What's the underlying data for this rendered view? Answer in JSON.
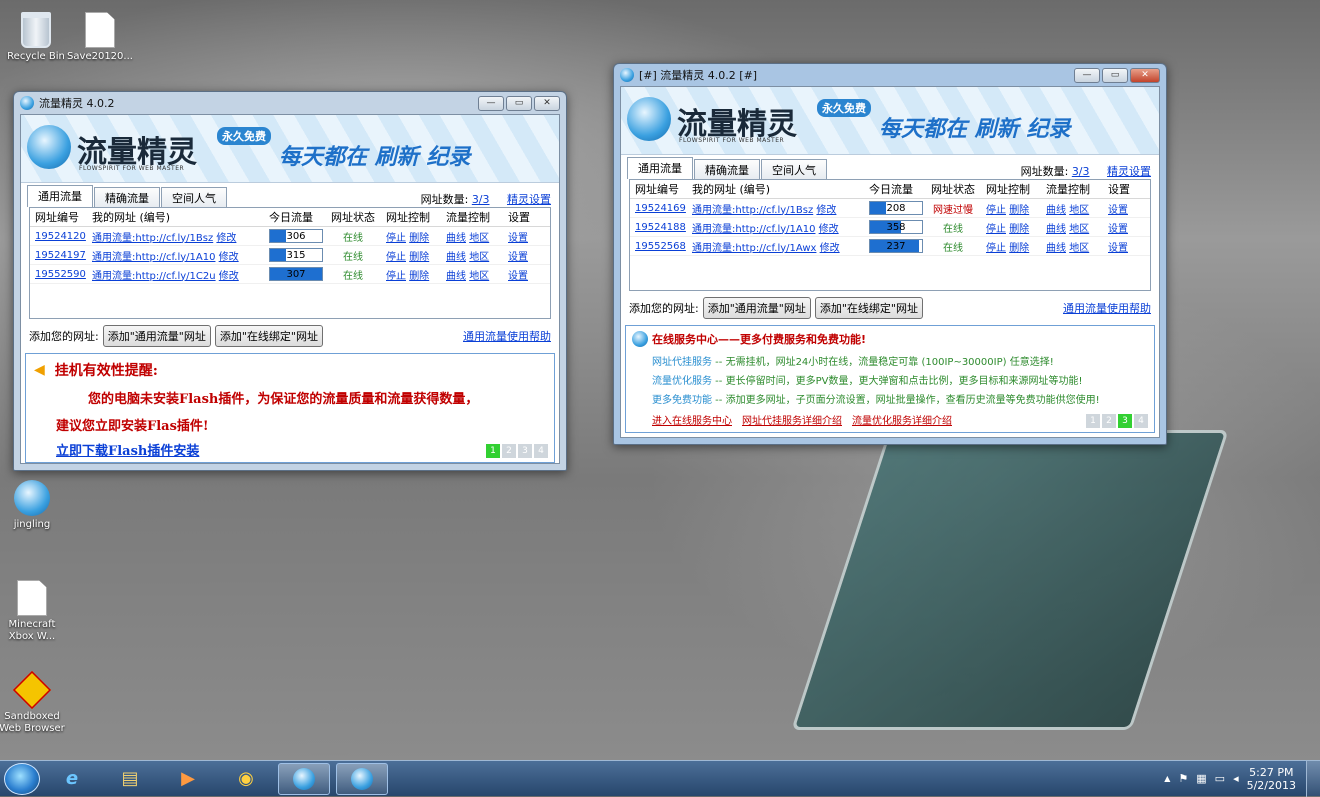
{
  "desktop": {
    "icons": [
      {
        "label": "Recycle Bin",
        "icon": "recycle-bin-icon"
      },
      {
        "label": "Save20120...",
        "icon": "document-icon"
      },
      {
        "label": "jingling",
        "icon": "jingling-app-icon"
      },
      {
        "label": "Minecraft Xbox W...",
        "icon": "document-icon"
      },
      {
        "label": "Sandboxed Web Browser",
        "icon": "sandboxed-browser-icon"
      }
    ]
  },
  "common": {
    "brand_name": "流量精灵",
    "brand_sub": "FLOWSPIRIT FOR WEB MASTER",
    "free_badge": "永久免费",
    "slogan": "每天都在 刷新 纪录",
    "tabs": [
      "通用流量",
      "精确流量",
      "空间人气"
    ],
    "url_count_label": "网址数量:",
    "url_count": "3/3",
    "settings_link": "精灵设置",
    "columns": [
      "网址编号",
      "我的网址 (编号)",
      "今日流量",
      "网址状态",
      "网址控制",
      "流量控制",
      "设置"
    ],
    "edit_label": "修改",
    "stop_label": "停止",
    "delete_label": "删除",
    "curve_label": "曲线",
    "region_label": "地区",
    "setup_label": "设置",
    "add_label": "添加您的网址:",
    "add_btn1": "添加\"通用流量\"网址",
    "add_btn2": "添加\"在线绑定\"网址",
    "help_link": "通用流量使用帮助",
    "pages": [
      "1",
      "2",
      "3",
      "4"
    ]
  },
  "window1": {
    "title": "流量精灵 4.0.2",
    "rows": [
      {
        "id": "19524120",
        "url": "通用流量:http://cf.ly/1Bsz",
        "traffic": "306",
        "fill": 0.3,
        "status": "在线"
      },
      {
        "id": "19524197",
        "url": "通用流量:http://cf.ly/1A10",
        "traffic": "315",
        "fill": 0.3,
        "status": "在线"
      },
      {
        "id": "19552590",
        "url": "通用流量:http://cf.ly/1C2u",
        "traffic": "307",
        "fill": 1.0,
        "status": "在线"
      }
    ],
    "notice_title": "挂机有效性提醒:",
    "notice_line1": "您的电脑未安装Flash插件，为保证您的流量质量和流量获得数量，",
    "notice_line2": "建议您立即安装Flas插件!",
    "notice_link": "立即下载Flash插件安装",
    "active_page": 1
  },
  "window2": {
    "title": "[#] 流量精灵 4.0.2 [#]",
    "rows": [
      {
        "id": "19524169",
        "url": "通用流量:http://cf.ly/1Bsz",
        "traffic": "208",
        "fill": 0.3,
        "status": "网速过慢"
      },
      {
        "id": "19524188",
        "url": "通用流量:http://cf.ly/1A10",
        "traffic": "358",
        "fill": 0.6,
        "status": "在线"
      },
      {
        "id": "19552568",
        "url": "通用流量:http://cf.ly/1Awx",
        "traffic": "237",
        "fill": 0.95,
        "status": "在线"
      }
    ],
    "service_title": "在线服务中心——更多付费服务和免费功能!",
    "services": [
      {
        "name": "网址代挂服务",
        "desc": " -- 无需挂机，网址24小时在线，流量稳定可靠 (100IP~30000IP) 任意选择!"
      },
      {
        "name": "流量优化服务",
        "desc": " -- 更长停留时间，更多PV数量，更大弹窗和点击比例，更多目标和来源网址等功能!"
      },
      {
        "name": "更多免费功能",
        "desc": " -- 添加更多网址，子页面分流设置，网址批量操作，查看历史流量等免费功能供您使用!"
      }
    ],
    "service_links": [
      "进入在线服务中心",
      "网址代挂服务详细介绍",
      "流量优化服务详细介绍"
    ],
    "active_page": 3
  },
  "taskbar": {
    "time": "5:27 PM",
    "date": "5/2/2013",
    "tray_arrow": "▲"
  },
  "colors": {
    "accent": "#1e6fd0",
    "online": "#2e8b2e",
    "warn": "#c00000"
  }
}
